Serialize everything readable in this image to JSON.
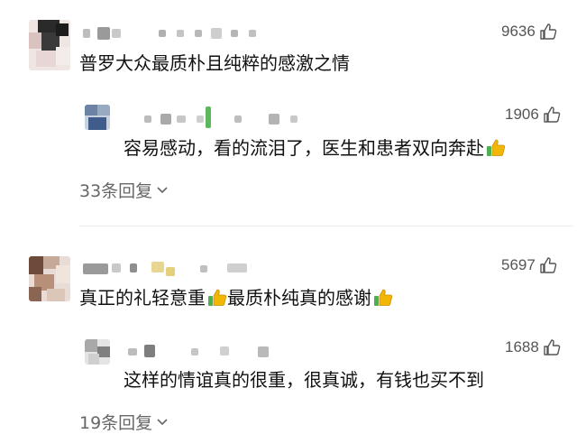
{
  "comments": [
    {
      "text": "普罗大众最质朴且纯粹的感激之情",
      "likes": "9636",
      "reply": {
        "text": "容易感动，看的流泪了，医生和患者双向奔赴",
        "likes": "1906"
      },
      "replies_label": "33条回复"
    },
    {
      "text_part1": "真正的礼轻意重",
      "text_part2": "最质朴纯真的感谢",
      "likes": "5697",
      "reply": {
        "text": "这样的情谊真的很重，很真诚，有钱也买不到",
        "likes": "1688"
      },
      "replies_label": "19条回复"
    }
  ],
  "icons": {
    "like": "thumbs-up-outline-icon",
    "emoji": "thumbs-up-emoji-icon",
    "expand": "chevron-down-icon"
  }
}
